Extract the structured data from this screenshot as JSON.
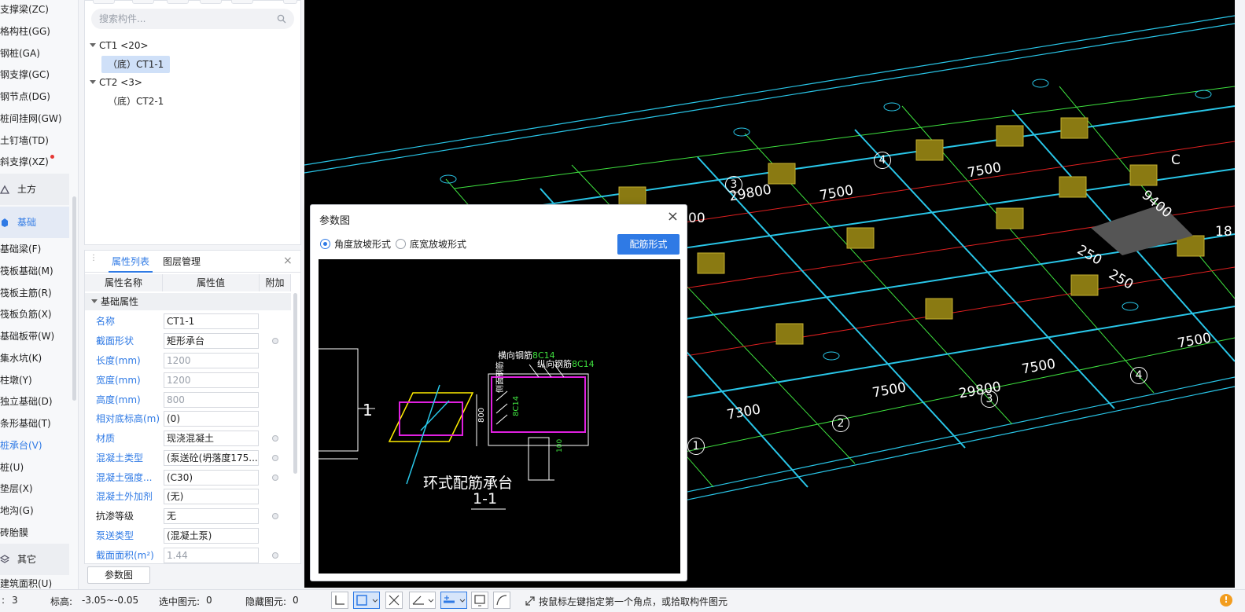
{
  "nav": {
    "items": [
      {
        "label": "支撑梁(ZC)",
        "active": false,
        "dot": false
      },
      {
        "label": "格构柱(GG)",
        "active": false,
        "dot": false
      },
      {
        "label": "钢桩(GA)",
        "active": false,
        "dot": false
      },
      {
        "label": "钢支撑(GC)",
        "active": false,
        "dot": false
      },
      {
        "label": "钢节点(DG)",
        "active": false,
        "dot": false
      },
      {
        "label": "桩间挂网(GW)",
        "active": false,
        "dot": false
      },
      {
        "label": "土钉墙(TD)",
        "active": false,
        "dot": false
      },
      {
        "label": "斜支撑(XZ)",
        "active": false,
        "dot": true
      }
    ],
    "group_earth": "土方",
    "group_foundation": "基础",
    "foundation_items": [
      {
        "label": "基础梁(F)",
        "active": false
      },
      {
        "label": "筏板基础(M)",
        "active": false
      },
      {
        "label": "筏板主筋(R)",
        "active": false
      },
      {
        "label": "筏板负筋(X)",
        "active": false
      },
      {
        "label": "基础板带(W)",
        "active": false
      },
      {
        "label": "集水坑(K)",
        "active": false
      },
      {
        "label": "柱墩(Y)",
        "active": false
      },
      {
        "label": "独立基础(D)",
        "active": false
      },
      {
        "label": "条形基础(T)",
        "active": false
      },
      {
        "label": "桩承台(V)",
        "active": true
      },
      {
        "label": "桩(U)",
        "active": false
      },
      {
        "label": "垫层(X)",
        "active": false
      },
      {
        "label": "地沟(G)",
        "active": false
      },
      {
        "label": "砖胎膜",
        "active": false
      }
    ],
    "group_other": "其它",
    "cut_item": "建筑面积(U)"
  },
  "components": {
    "search_placeholder": "搜索构件...",
    "tree": [
      {
        "label": "CT1 <20>",
        "children": [
          {
            "label": "（底）CT1-1",
            "selected": true
          }
        ]
      },
      {
        "label": "CT2 <3>",
        "children": [
          {
            "label": "（底）CT2-1",
            "selected": false
          }
        ]
      }
    ]
  },
  "properties": {
    "tab_props": "属性列表",
    "tab_layers": "图层管理",
    "col_name": "属性名称",
    "col_value": "属性值",
    "col_extra": "附加",
    "section": "基础属性",
    "rows": [
      {
        "name": "名称",
        "value": "CT1-1",
        "link": true,
        "disabled": false,
        "dot": false
      },
      {
        "name": "截面形状",
        "value": "矩形承台",
        "link": true,
        "disabled": false,
        "dot": true
      },
      {
        "name": "长度(mm)",
        "value": "1200",
        "link": true,
        "disabled": true,
        "dot": false
      },
      {
        "name": "宽度(mm)",
        "value": "1200",
        "link": true,
        "disabled": true,
        "dot": false
      },
      {
        "name": "高度(mm)",
        "value": "800",
        "link": true,
        "disabled": true,
        "dot": false
      },
      {
        "name": "相对底标高(m)",
        "value": "(0)",
        "link": true,
        "disabled": false,
        "dot": false
      },
      {
        "name": "材质",
        "value": "现浇混凝土",
        "link": true,
        "disabled": false,
        "dot": true
      },
      {
        "name": "混凝土类型",
        "value": "(泵送砼(坍落度175...",
        "link": true,
        "disabled": false,
        "dot": true
      },
      {
        "name": "混凝土强度...",
        "value": "(C30)",
        "link": true,
        "disabled": false,
        "dot": true
      },
      {
        "name": "混凝土外加剂",
        "value": "(无)",
        "link": true,
        "disabled": false,
        "dot": false
      },
      {
        "name": "抗渗等级",
        "value": "无",
        "link": false,
        "disabled": false,
        "dot": true
      },
      {
        "name": "泵送类型",
        "value": "(混凝土泵)",
        "link": true,
        "disabled": false,
        "dot": false
      },
      {
        "name": "截面面积(m²)",
        "value": "1.44",
        "link": true,
        "disabled": true,
        "dot": true
      }
    ],
    "param_button": "参数图"
  },
  "cad": {
    "labels": [
      "29800",
      "7500",
      "7500",
      "9400",
      "250",
      "250",
      "7500",
      "7500",
      "7500",
      "29800",
      "7300",
      "00",
      "18",
      "C"
    ],
    "axis_numbers": [
      "1",
      "2",
      "3",
      "3",
      "4",
      "4"
    ]
  },
  "dialog": {
    "title": "参数图",
    "radio_angle": "角度放坡形式",
    "radio_width": "底宽放坡形式",
    "rebar_button": "配筋形式",
    "drawing": {
      "title": "环式配筋承台",
      "section": "1-1",
      "label_h": "横向钢筋",
      "label_v": "纵向钢筋",
      "rebar_h": "8C14",
      "rebar_v": "8C14",
      "side_label": "侧面钢筋",
      "side_rebar": "8C14",
      "dim_800": "800",
      "dim_100": "100",
      "mark_1": "1"
    }
  },
  "status": {
    "layer_label": ":",
    "layer_value": "3",
    "elev_label": "标高:",
    "elev_value": "-3.05~-0.05",
    "selected_label": "选中图元:",
    "selected_value": "0",
    "hidden_label": "隐藏图元:",
    "hidden_value": "0",
    "hint": "按鼠标左键指定第一个角点，或拾取构件图元",
    "warn": "!"
  },
  "colors": {
    "accent": "#2f7ae5",
    "cad_bg": "#000000",
    "grid_cyan": "#29c6e8",
    "grid_green": "#3fe23f",
    "grid_red": "#e02020",
    "cap_yellow": "#8a7a12",
    "rebar_magenta": "#e020e0"
  }
}
